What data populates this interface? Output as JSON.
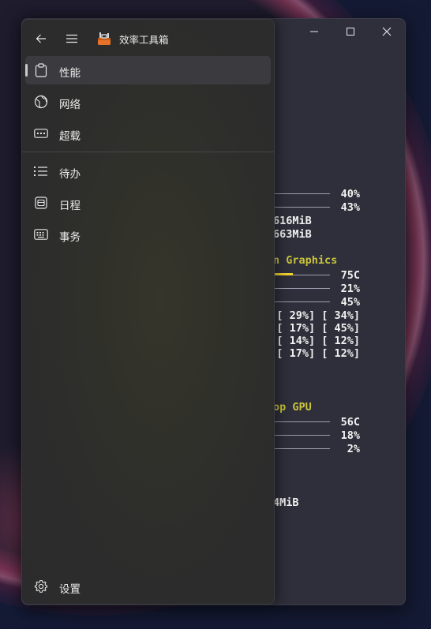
{
  "app": {
    "title": "效率工具箱"
  },
  "caption": {
    "minimize": "minimize-icon",
    "maximize": "maximize-icon",
    "close": "close-icon"
  },
  "nav": {
    "top": [
      {
        "label": "性能",
        "icon": "clipboard-icon",
        "selected": true
      },
      {
        "label": "网络",
        "icon": "globe-icon",
        "selected": false
      },
      {
        "label": "超载",
        "icon": "keyboard-icon",
        "selected": false
      }
    ],
    "bottom": [
      {
        "label": "待办",
        "icon": "list-icon",
        "selected": false
      },
      {
        "label": "日程",
        "icon": "calendar-icon",
        "selected": false
      },
      {
        "label": "事务",
        "icon": "keyboard-grid-icon",
        "selected": false
      }
    ],
    "footer": {
      "label": "设置",
      "icon": "gear-icon"
    }
  },
  "monitor": {
    "cpu": {
      "bar1_pct": "40%",
      "bar2_pct": "43%",
      "mem1": "616MiB",
      "mem2": "663MiB"
    },
    "igpu": {
      "name_fragment": "n Graphics",
      "temp": "75C",
      "temp_level": 0.35,
      "util": "21%",
      "mem": "45%",
      "cores": [
        "[ 29%] [ 34%]",
        "[ 17%] [ 45%]",
        "[ 14%] [ 12%]",
        "[ 17%] [ 12%]"
      ]
    },
    "dgpu": {
      "name_fragment": "op GPU",
      "temp": "56C",
      "util": "18%",
      "mem": "2%",
      "mem_used": "4MiB"
    }
  }
}
